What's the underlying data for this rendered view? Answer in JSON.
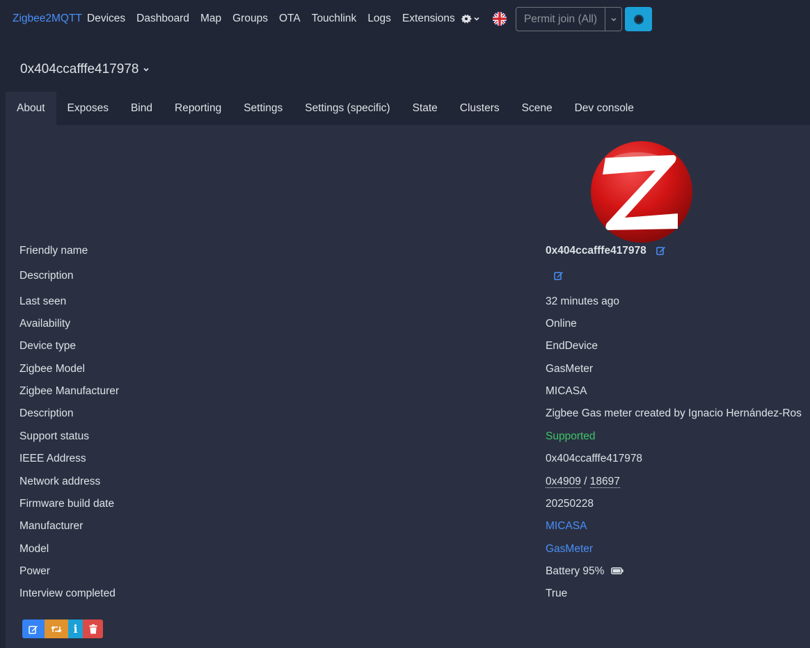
{
  "navbar": {
    "brand": "Zigbee2MQTT",
    "links": [
      "Devices",
      "Dashboard",
      "Map",
      "Groups",
      "OTA",
      "Touchlink",
      "Logs",
      "Extensions"
    ],
    "permit_join_label": "Permit join (All)",
    "icons": {
      "settings": "gear-icon",
      "language": "uk-flag-icon",
      "status": "circle-icon"
    }
  },
  "device": {
    "title": "0x404ccafffe417978"
  },
  "tabs": [
    "About",
    "Exposes",
    "Bind",
    "Reporting",
    "Settings",
    "Settings (specific)",
    "State",
    "Clusters",
    "Scene",
    "Dev console"
  ],
  "active_tab": "About",
  "info": {
    "friendly_name_label": "Friendly name",
    "friendly_name": "0x404ccafffe417978",
    "description_label": "Description",
    "last_seen_label": "Last seen",
    "last_seen": "32 minutes ago",
    "availability_label": "Availability",
    "availability": "Online",
    "device_type_label": "Device type",
    "device_type": "EndDevice",
    "zigbee_model_label": "Zigbee Model",
    "zigbee_model": "GasMeter",
    "zigbee_manufacturer_label": "Zigbee Manufacturer",
    "zigbee_manufacturer": "MICASA",
    "description2_label": "Description",
    "description2": "Zigbee Gas meter created by Ignacio Hernández-Ros",
    "support_status_label": "Support status",
    "support_status": "Supported",
    "ieee_label": "IEEE Address",
    "ieee": "0x404ccafffe417978",
    "network_label": "Network address",
    "network_hex": "0x4909",
    "network_sep": "/",
    "network_dec": "18697",
    "firmware_label": "Firmware build date",
    "firmware": "20250228",
    "manufacturer_label": "Manufacturer",
    "manufacturer": "MICASA",
    "model_label": "Model",
    "model": "GasMeter",
    "power_label": "Power",
    "power": "Battery 95%",
    "interview_label": "Interview completed",
    "interview": "True"
  },
  "colors": {
    "background": "#212636",
    "panel": "#2a3042",
    "link": "#4a8ff7",
    "supported": "#3fc467",
    "btn_edit": "#3583f5",
    "btn_reconfigure": "#e0922e",
    "btn_info": "#1ba1d8",
    "btn_delete": "#dc4a47"
  },
  "actions": {
    "info_label": "i"
  }
}
